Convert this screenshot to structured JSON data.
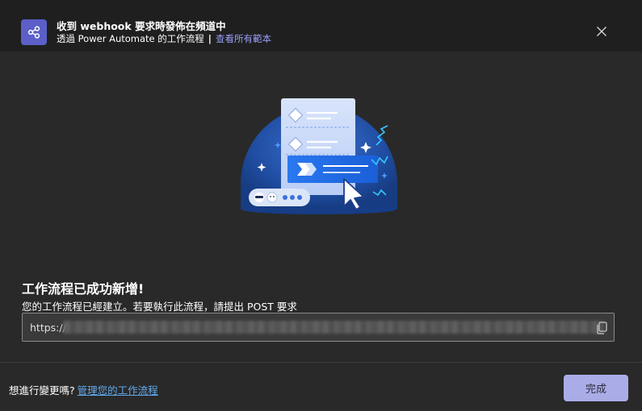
{
  "header": {
    "title": "收到 webhook 要求時發佈在頻道中",
    "subtitle": "透過 Power Automate 的工作流程",
    "separator": "|",
    "templates_link": "查看所有範本",
    "app_icon": "share-icon",
    "close_icon": "close-icon"
  },
  "main": {
    "success_title": "工作流程已成功新增!",
    "success_desc": "您的工作流程已經建立。若要執行此流程，請提出 POST 要求",
    "url_prefix": "https://",
    "copy_icon": "copy-icon"
  },
  "footer": {
    "question": "想進行變更嗎?",
    "manage_link": "管理您的工作流程",
    "done_label": "完成"
  },
  "colors": {
    "accent": "#5b5fc7",
    "link": "#9a9ef8",
    "footer_link": "#62a8ea",
    "primary_button": "#aaace8"
  }
}
